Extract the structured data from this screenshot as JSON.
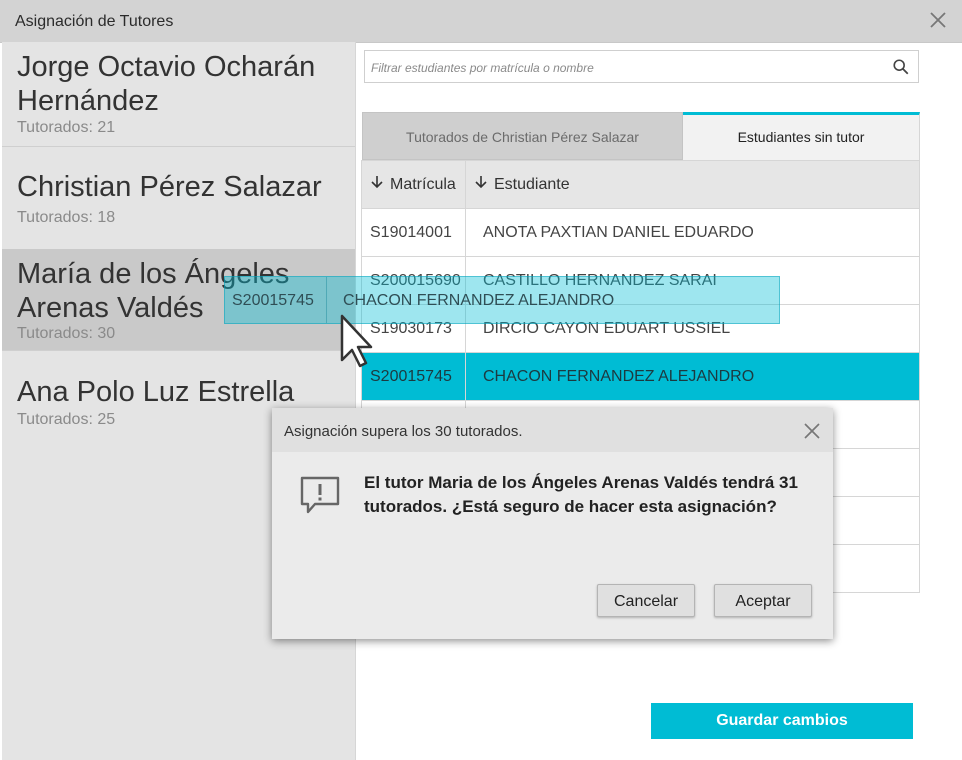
{
  "window": {
    "title": "Asignación de Tutores"
  },
  "tutors": [
    {
      "name_line1": "Jorge Octavio Ocharán",
      "name_line2": "Hernández",
      "count": "Tutorados: 21"
    },
    {
      "name_line1": "Christian Pérez Salazar",
      "name_line2": "",
      "count": "Tutorados: 18"
    },
    {
      "name_line1": "María de los Ángeles",
      "name_line2": "Arenas Valdés",
      "count": "Tutorados: 30"
    },
    {
      "name_line1": "Ana Polo Luz Estrella",
      "name_line2": "",
      "count": "Tutorados: 25"
    }
  ],
  "search": {
    "placeholder": "Filtrar estudiantes por matrícula o nombre",
    "icon": "search-icon"
  },
  "tabs": [
    {
      "label": "Tutorados de Christian Pérez Salazar",
      "active": false
    },
    {
      "label": "Estudiantes sin tutor",
      "active": true
    }
  ],
  "grid": {
    "headers": [
      "Matrícula",
      "Estudiante"
    ],
    "rows": [
      {
        "matricula": "S19014001",
        "estudiante": "ANOTA PAXTIAN DANIEL EDUARDO"
      },
      {
        "matricula": "S200015690",
        "estudiante": "CASTILLO HERNANDEZ SARAI"
      },
      {
        "matricula": "S19030173",
        "estudiante": "DIRCIO CAYON EDUART USSIEL"
      },
      {
        "matricula": "S20015745",
        "estudiante": "CHACON FERNANDEZ ALEJANDRO",
        "selected": true
      },
      {
        "matricula": "",
        "estudiante": ""
      },
      {
        "matricula": "",
        "estudiante": ""
      },
      {
        "matricula": "",
        "estudiante": ""
      },
      {
        "matricula": "",
        "estudiante": ""
      }
    ]
  },
  "drag": {
    "matricula": "S20015745",
    "estudiante": "CHACON FERNANDEZ ALEJANDRO"
  },
  "dialog": {
    "title": "Asignación supera los 30 tutorados.",
    "message": "El tutor Maria de los Ángeles Arenas Valdés tendrá 31 tutorados. ¿Está seguro de hacer esta asignación?",
    "cancel_label": "Cancelar",
    "accept_label": "Aceptar"
  },
  "save_label": "Guardar cambios",
  "colors": {
    "accent": "#00bcd4",
    "selected_tutor": "#c9c9c9",
    "sidebar": "#e4e4e4"
  }
}
